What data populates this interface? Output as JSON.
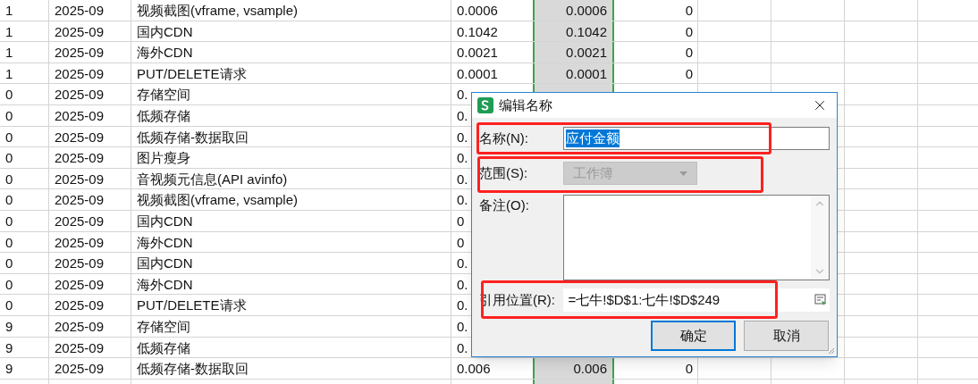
{
  "sheet": {
    "rows": [
      {
        "a": "1",
        "b": "2025-09",
        "c": "视频截图(vframe, vsample)",
        "d": "0.0006",
        "e": "0.0006",
        "f": "0"
      },
      {
        "a": "1",
        "b": "2025-09",
        "c": "国内CDN",
        "d": "0.1042",
        "e": "0.1042",
        "f": "0"
      },
      {
        "a": "1",
        "b": "2025-09",
        "c": "海外CDN",
        "d": "0.0021",
        "e": "0.0021",
        "f": "0"
      },
      {
        "a": "1",
        "b": "2025-09",
        "c": "PUT/DELETE请求",
        "d": "0.0001",
        "e": "0.0001",
        "f": "0"
      },
      {
        "a": "0",
        "b": "2025-09",
        "c": "存储空间",
        "d": "0."
      },
      {
        "a": "0",
        "b": "2025-09",
        "c": "低频存储",
        "d": "0."
      },
      {
        "a": "0",
        "b": "2025-09",
        "c": "低频存储-数据取回",
        "d": "0."
      },
      {
        "a": "0",
        "b": "2025-09",
        "c": "图片瘦身",
        "d": "0."
      },
      {
        "a": "0",
        "b": "2025-09",
        "c": "音视频元信息(API avinfo)",
        "d": "0."
      },
      {
        "a": "0",
        "b": "2025-09",
        "c": "视频截图(vframe, vsample)",
        "d": "0."
      },
      {
        "a": "0",
        "b": "2025-09",
        "c": "国内CDN",
        "d": "0"
      },
      {
        "a": "0",
        "b": "2025-09",
        "c": "海外CDN",
        "d": "0"
      },
      {
        "a": "0",
        "b": "2025-09",
        "c": "国内CDN",
        "d": "0."
      },
      {
        "a": "0",
        "b": "2025-09",
        "c": "海外CDN",
        "d": "0."
      },
      {
        "a": "0",
        "b": "2025-09",
        "c": "PUT/DELETE请求",
        "d": "0."
      },
      {
        "a": "9",
        "b": "2025-09",
        "c": "存储空间",
        "d": "0."
      },
      {
        "a": "9",
        "b": "2025-09",
        "c": "低频存储",
        "d": "0."
      },
      {
        "a": "9",
        "b": "2025-09",
        "c": "低频存储-数据取回",
        "d": "0.006",
        "e": "0.006",
        "f": "0"
      }
    ]
  },
  "dialog": {
    "title": "编辑名称",
    "name": {
      "label": "名称(N):",
      "value": "应付金额",
      "selected": true,
      "highlighted": true
    },
    "scope": {
      "label": "范围(S):",
      "value": "工作簿",
      "disabled": true,
      "highlighted": true
    },
    "comment": {
      "label": "备注(O):"
    },
    "reference": {
      "label": "引用位置(R):",
      "value": "=七牛!$D$1:七牛!$D$249",
      "highlighted": true
    },
    "buttons": [
      {
        "label": "确定",
        "default": true
      },
      {
        "label": "取消",
        "default": false
      }
    ]
  }
}
